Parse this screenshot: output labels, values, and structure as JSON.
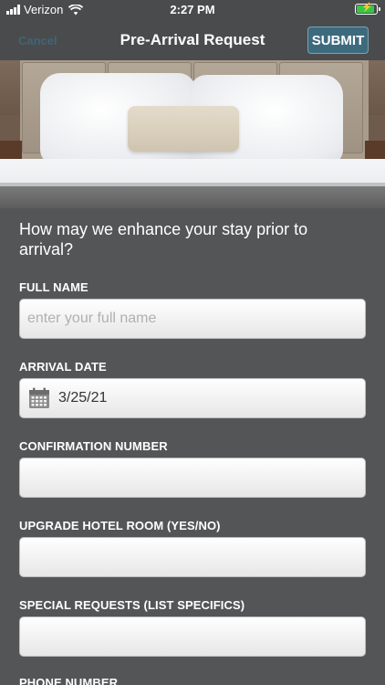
{
  "status_bar": {
    "carrier": "Verizon",
    "time": "2:27 PM"
  },
  "nav": {
    "cancel_label": "Cancel",
    "title": "Pre-Arrival Request",
    "submit_label": "SUBMIT"
  },
  "form": {
    "intro": "How may we enhance your stay prior to arrival?",
    "fields": [
      {
        "label": "FULL NAME",
        "value": "",
        "placeholder": "enter your full name"
      },
      {
        "label": "ARRIVAL DATE",
        "value": "3/25/21",
        "placeholder": ""
      },
      {
        "label": "CONFIRMATION NUMBER",
        "value": "",
        "placeholder": ""
      },
      {
        "label": "UPGRADE HOTEL ROOM (YES/NO)",
        "value": "",
        "placeholder": ""
      },
      {
        "label": "SPECIAL REQUESTS (LIST SPECIFICS)",
        "value": "",
        "placeholder": ""
      },
      {
        "label": "PHONE NUMBER",
        "value": "",
        "placeholder": ""
      }
    ]
  },
  "colors": {
    "background": "#545556",
    "bar": "#4a4b4c",
    "submit": "#3e6a7e",
    "cancel": "#3f6577",
    "battery": "#39c54a"
  },
  "icons": {
    "calendar": "calendar-icon",
    "wifi": "wifi-icon",
    "signal": "signal-icon",
    "battery": "battery-icon"
  }
}
